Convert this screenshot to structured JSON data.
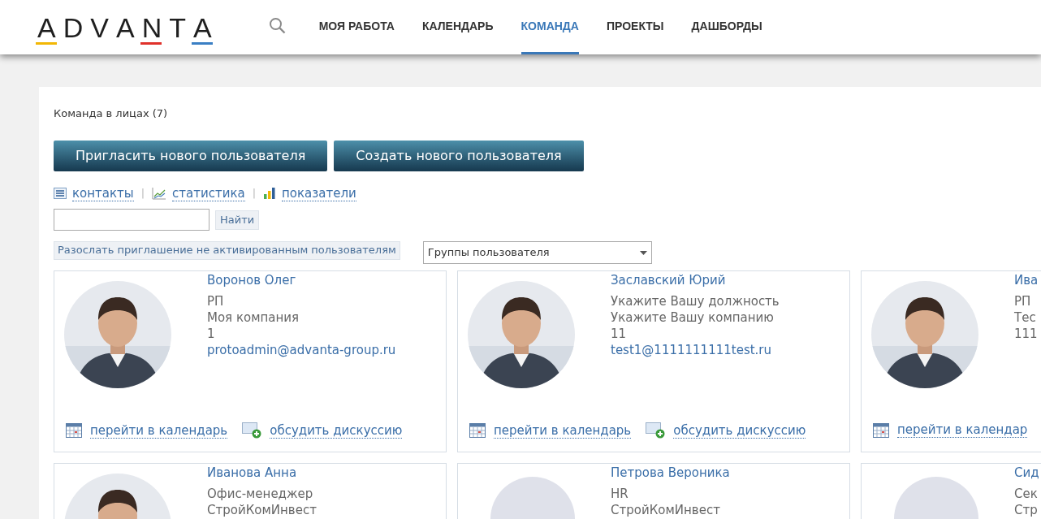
{
  "logo": {
    "text": "ADVANTA",
    "accents": [
      {
        "color": "#f2b705"
      },
      {
        "color": "#e0312b"
      },
      {
        "color": "#3a7fc4"
      }
    ]
  },
  "nav": [
    {
      "label": "МОЯ РАБОТА",
      "selected": false
    },
    {
      "label": "КАЛЕНДАРЬ",
      "selected": false
    },
    {
      "label": "КОМАНДА",
      "selected": true
    },
    {
      "label": "ПРОЕКТЫ",
      "selected": false
    },
    {
      "label": "ДАШБОРДЫ",
      "selected": false
    }
  ],
  "page_title": "Команда в лицах (7)",
  "buttons": [
    "Пригласить нового пользователя",
    "Создать нового пользователя"
  ],
  "views": [
    {
      "kind": "list",
      "label": "контакты"
    },
    {
      "kind": "stats",
      "label": "статистика"
    },
    {
      "kind": "bars",
      "label": "показатели"
    }
  ],
  "view_separators": [
    "|",
    "|"
  ],
  "search": {
    "button": "Найти"
  },
  "invite_button": "Разослать приглашение не активированным пользователям",
  "groups_select": {
    "value": "Группы пользователя"
  },
  "cards": [
    {
      "name": "Воронов Олег",
      "has_photo": true,
      "lines": [
        "РП",
        "Моя компания",
        "1"
      ],
      "email": "protoadmin@advanta-group.ru",
      "actions": [
        "перейти в календарь",
        "обсудить дискуссию"
      ]
    },
    {
      "name": "Заславский Юрий",
      "has_photo": true,
      "lines": [
        "Укажите Вашу должность",
        "Укажите Вашу компанию",
        "11"
      ],
      "email": "test1@1111111111test.ru",
      "actions": [
        "перейти в календарь",
        "обсудить дискуссию"
      ]
    },
    {
      "name": "Ива",
      "has_photo": true,
      "lines": [
        "РП",
        "Тес",
        "111"
      ],
      "actions": [
        "перейти в календар"
      ]
    },
    {
      "name": "Иванова Анна",
      "has_photo": true,
      "lines": [
        "Офис-менеджер",
        "СтройКомИнвест"
      ]
    },
    {
      "name": "Петрова Вероника",
      "has_photo": false,
      "lines": [
        "HR",
        "СтройКомИнвест"
      ]
    },
    {
      "name": "Сид",
      "has_photo": false,
      "lines": [
        "Сек",
        "Стр"
      ]
    }
  ]
}
